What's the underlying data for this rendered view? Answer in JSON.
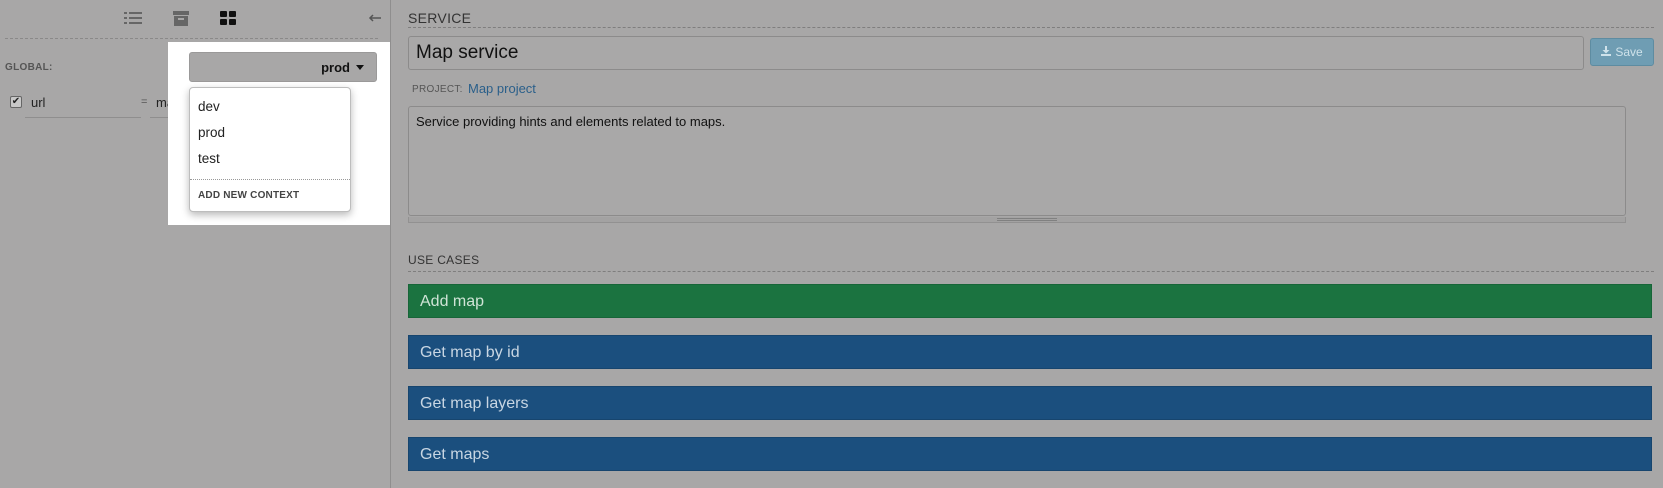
{
  "left": {
    "toolbar": {
      "list_icon": "list-icon",
      "archive_icon": "archive-icon",
      "grid_icon": "grid-icon",
      "collapse_icon": "arrow-left-icon"
    },
    "global_label": "GLOBAL:",
    "variables": [
      {
        "enabled": true,
        "key": "url",
        "equals": "=",
        "value": "mapa"
      }
    ],
    "context": {
      "selected": "prod",
      "options": [
        "dev",
        "prod",
        "test"
      ],
      "add_new": "ADD NEW CONTEXT"
    }
  },
  "service": {
    "section_title": "SERVICE",
    "name": "Map service",
    "save_label": "Save",
    "project_label": "PROJECT:",
    "project_name": "Map project",
    "description": "Service providing hints and elements related to maps."
  },
  "use_cases": {
    "section_title": "USE CASES",
    "items": [
      {
        "label": "Add map",
        "color": "#1b7340"
      },
      {
        "label": "Get map by id",
        "color": "#1b4f7e"
      },
      {
        "label": "Get map layers",
        "color": "#1b4f7e"
      },
      {
        "label": "Get maps",
        "color": "#1b4f7e"
      }
    ]
  }
}
